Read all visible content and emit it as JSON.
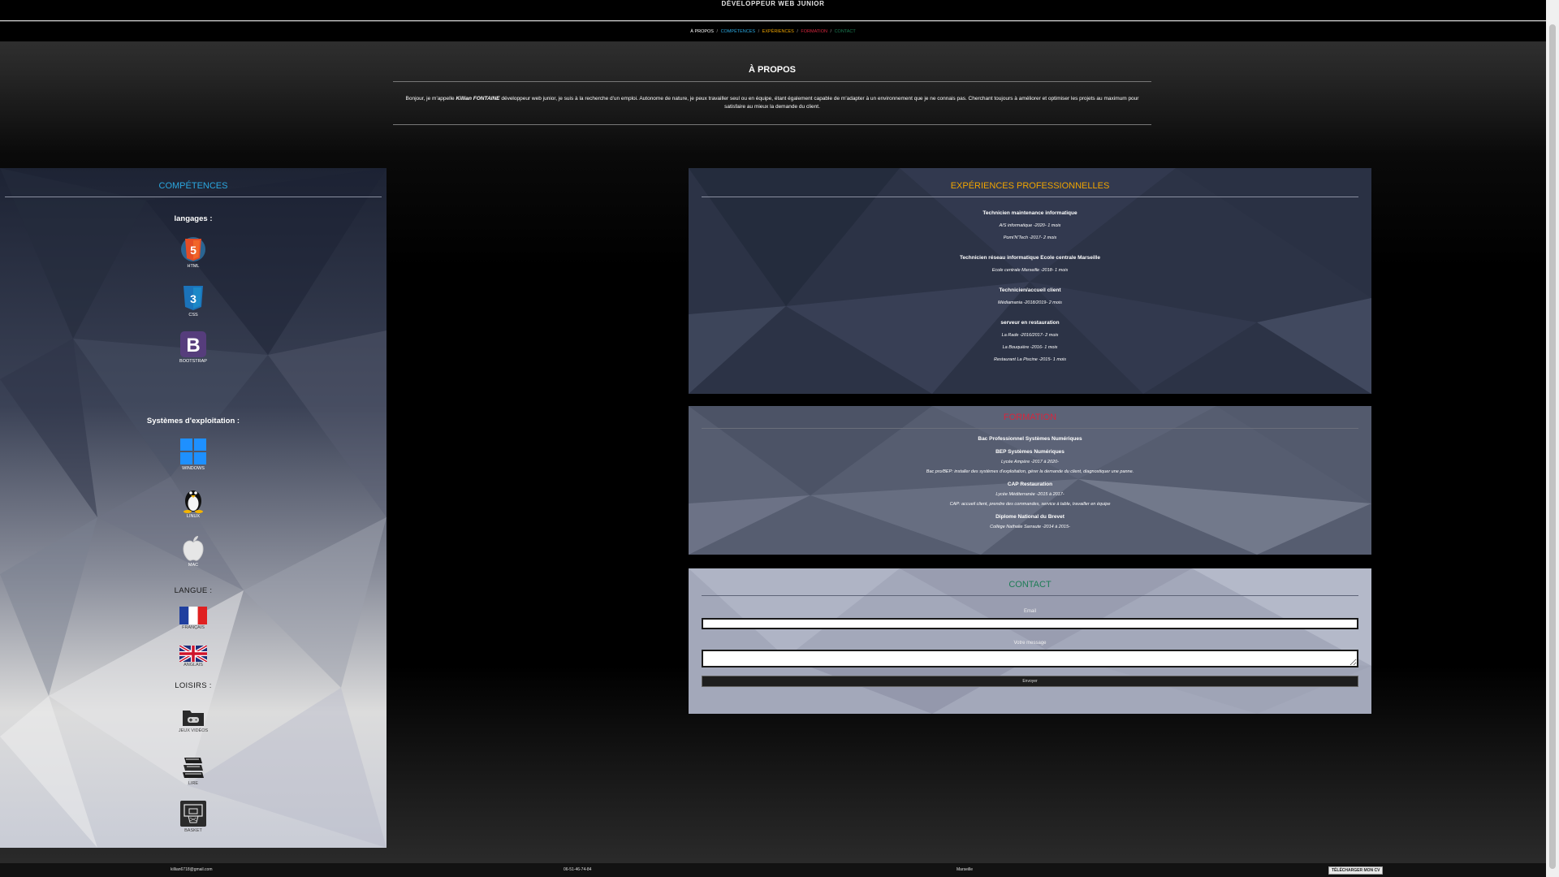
{
  "header": {
    "site_title": "DÉVELOPPEUR WEB JUNIOR"
  },
  "nav": {
    "items": [
      {
        "label": "À PROPOS",
        "color": "#ffffff"
      },
      {
        "label": "COMPÉTENCES",
        "color": "#2ba8e0"
      },
      {
        "label": "EXPÉRIENCES",
        "color": "#f0a500"
      },
      {
        "label": "FORMATION",
        "color": "#d7263d"
      },
      {
        "label": "CONTACT",
        "color": "#1c7c54"
      }
    ],
    "separator": "/"
  },
  "about": {
    "title": "À PROPOS",
    "text_before": "Bonjour, je m'appelle ",
    "name": "Killian FONTAINE",
    "text_after": " développeur web junior, je suis à la recherche d'un emploi. Autonome de nature, je peux travailler seul ou en équipe, étant également capable de m'adapter à un environnement que je ne connais pas. Cherchant toujours à améliorer et optimiser les projets au maximum pour satisfaire au mieux la demande du client."
  },
  "skills": {
    "title": "COMPÉTENCES",
    "languages_title": "langages :",
    "languages": [
      {
        "label": "HTML",
        "icon": "html5-icon"
      },
      {
        "label": "CSS",
        "icon": "css3-icon"
      },
      {
        "label": "BOOTSTRAP",
        "icon": "bootstrap-icon"
      }
    ],
    "os_title": "Systèmes d'exploitation :",
    "os": [
      {
        "label": "WINDOWS",
        "icon": "windows-icon"
      },
      {
        "label": "LINUX",
        "icon": "linux-icon"
      },
      {
        "label": "MAC",
        "icon": "apple-icon"
      }
    ],
    "lang_title": "LANGUE :",
    "langs": [
      {
        "label": "FRANÇAIS",
        "icon": "france-flag-icon"
      },
      {
        "label": "ANGLAIS",
        "icon": "uk-flag-icon"
      }
    ],
    "hobbies_title": "LOISIRS :",
    "hobbies": [
      {
        "label": "JEUX VIDÉOS",
        "icon": "gamepad-folder-icon"
      },
      {
        "label": "LIRE",
        "icon": "books-icon"
      },
      {
        "label": "BASKET",
        "icon": "basketball-hoop-icon"
      }
    ]
  },
  "experience": {
    "title": "EXPÉRIENCES PROFESSIONNELLES",
    "jobs": [
      {
        "title": "Technicien maintenance informatique",
        "lines": [
          "A/S informatique -2020- 1 mois",
          "Pomi'N'Tech -2017- 2 mois"
        ]
      },
      {
        "title": "Technicien réseau informatique Ecole centrale Marseille",
        "lines": [
          "Ecole centrale Marseille -2018- 1 mois"
        ]
      },
      {
        "title": "Technicien/accueil client",
        "lines": [
          "Médiamania -2018/2019- 2 mois"
        ]
      },
      {
        "title": "serveur en restauration",
        "lines": [
          "La Rade -2016/2017- 2 mois",
          "La Bouquière -2016- 1 mois",
          "Restaurant La Piscine -2015- 1 mois"
        ]
      }
    ]
  },
  "formation": {
    "title": "FORMATION",
    "lines": [
      {
        "text": "Bac Professionnel Systèmes Numériques",
        "style": "b"
      },
      {
        "text": "BEP Systèmes Numériques",
        "style": "b"
      },
      {
        "text": "Lycée Ampère -2017 à 2020-",
        "style": "i"
      },
      {
        "text": "Bac pro/BEP: installer des systèmes d'exploitation, gérer la demande du client, diagnostiquer une panne.",
        "style": "i"
      },
      {
        "text": "CAP Restauration",
        "style": "b"
      },
      {
        "text": "Lycée Méditerranée -2015 à 2017-",
        "style": "i"
      },
      {
        "text": "CAP: accueil client, prendre des commandes, service à table, travailler en équipe",
        "style": "i"
      },
      {
        "text": "Diplome National du Brevet",
        "style": "b"
      },
      {
        "text": "Collège Nathalie Sarraute -2014 à 2015-",
        "style": "i"
      }
    ]
  },
  "contact": {
    "title": "CONTACT",
    "email_label": "Email",
    "email_value": "",
    "message_label": "Votre message",
    "message_value": "",
    "send_label": "Envoyer"
  },
  "footer": {
    "email": "killian6718@gmail.com",
    "phone": "06-51-46-74-84",
    "city": "Marseille",
    "cv_button": "TÉLÉCHARGER MON CV"
  }
}
